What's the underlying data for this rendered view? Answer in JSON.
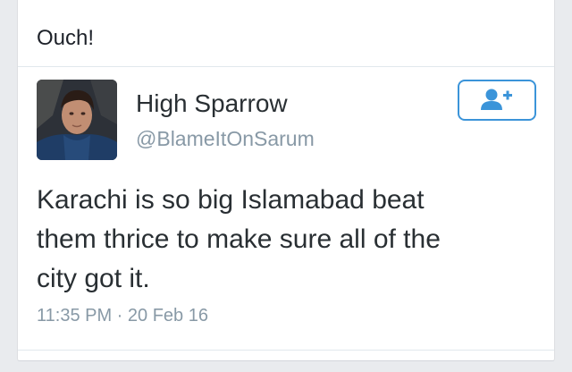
{
  "post": {
    "text": "Ouch!"
  },
  "tweet": {
    "user_name": "High Sparrow",
    "user_handle": "@BlameItOnSarum",
    "text": "Karachi is so big Islamabad beat\nthem thrice to make sure all of the\ncity got it.",
    "timestamp": "11:35 PM · 20 Feb 16",
    "follow_icon": "add-user-icon",
    "accent_color": "#3b94d9"
  }
}
